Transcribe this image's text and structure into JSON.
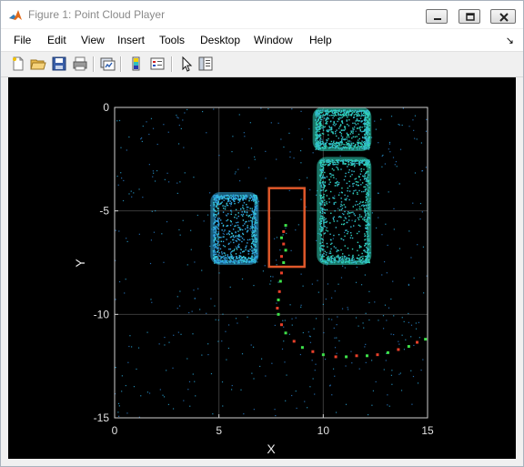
{
  "window": {
    "title": "Figure 1: Point Cloud Player",
    "icon": "matlab-icon",
    "controls": [
      "minimize-icon",
      "maximize-icon",
      "close-icon"
    ]
  },
  "menubar": {
    "items": [
      "File",
      "Edit",
      "View",
      "Insert",
      "Tools",
      "Desktop",
      "Window",
      "Help"
    ],
    "dock_icon": "dock-arrow-icon"
  },
  "toolbar": {
    "buttons": [
      "new-figure-icon",
      "open-file-icon",
      "save-icon",
      "print-icon",
      "link-plot-icon",
      "insert-colorbar-icon",
      "insert-legend-icon",
      "edit-plot-icon",
      "property-inspector-icon"
    ]
  },
  "chart_data": {
    "type": "scatter",
    "title": "",
    "xlabel": "X",
    "ylabel": "Y",
    "xlim": [
      0,
      15
    ],
    "ylim": [
      -15,
      0
    ],
    "xticks": [
      0,
      5,
      10,
      15
    ],
    "yticks": [
      0,
      -5,
      -10,
      -15
    ],
    "grid": true,
    "background": "#000000",
    "colors": {
      "point_cloud": "#2fbfe0",
      "vehicle_cluster": "#2fd3b8",
      "box": "#e0582a",
      "track_green": "#3ee24a",
      "track_red": "#e8402a"
    },
    "bounding_box": {
      "x": [
        7.4,
        9.1
      ],
      "y": [
        -7.7,
        -3.9
      ]
    },
    "vehicle_clusters": [
      {
        "x": [
          4.7,
          6.8
        ],
        "y": [
          -7.5,
          -4.2
        ]
      },
      {
        "x": [
          9.8,
          12.2
        ],
        "y": [
          -7.5,
          -2.5
        ]
      },
      {
        "x": [
          9.6,
          12.2
        ],
        "y": [
          -2.0,
          -0.1
        ]
      }
    ],
    "trajectory_points": [
      [
        8.2,
        -5.7
      ],
      [
        8.1,
        -6.0
      ],
      [
        8.0,
        -6.3
      ],
      [
        8.1,
        -6.6
      ],
      [
        8.2,
        -6.9
      ],
      [
        8.0,
        -7.2
      ],
      [
        8.1,
        -7.5
      ],
      [
        8.0,
        -8.0
      ],
      [
        7.95,
        -8.4
      ],
      [
        7.9,
        -8.9
      ],
      [
        7.85,
        -9.3
      ],
      [
        7.8,
        -9.7
      ],
      [
        7.85,
        -10.0
      ],
      [
        8.0,
        -10.5
      ],
      [
        8.2,
        -10.9
      ],
      [
        8.6,
        -11.3
      ],
      [
        9.0,
        -11.6
      ],
      [
        9.5,
        -11.8
      ],
      [
        10.0,
        -11.95
      ],
      [
        10.6,
        -12.05
      ],
      [
        11.1,
        -12.05
      ],
      [
        11.6,
        -12.0
      ],
      [
        12.1,
        -12.0
      ],
      [
        12.6,
        -11.95
      ],
      [
        13.1,
        -11.85
      ],
      [
        13.6,
        -11.7
      ],
      [
        14.1,
        -11.55
      ],
      [
        14.5,
        -11.35
      ],
      [
        14.9,
        -11.2
      ]
    ]
  }
}
